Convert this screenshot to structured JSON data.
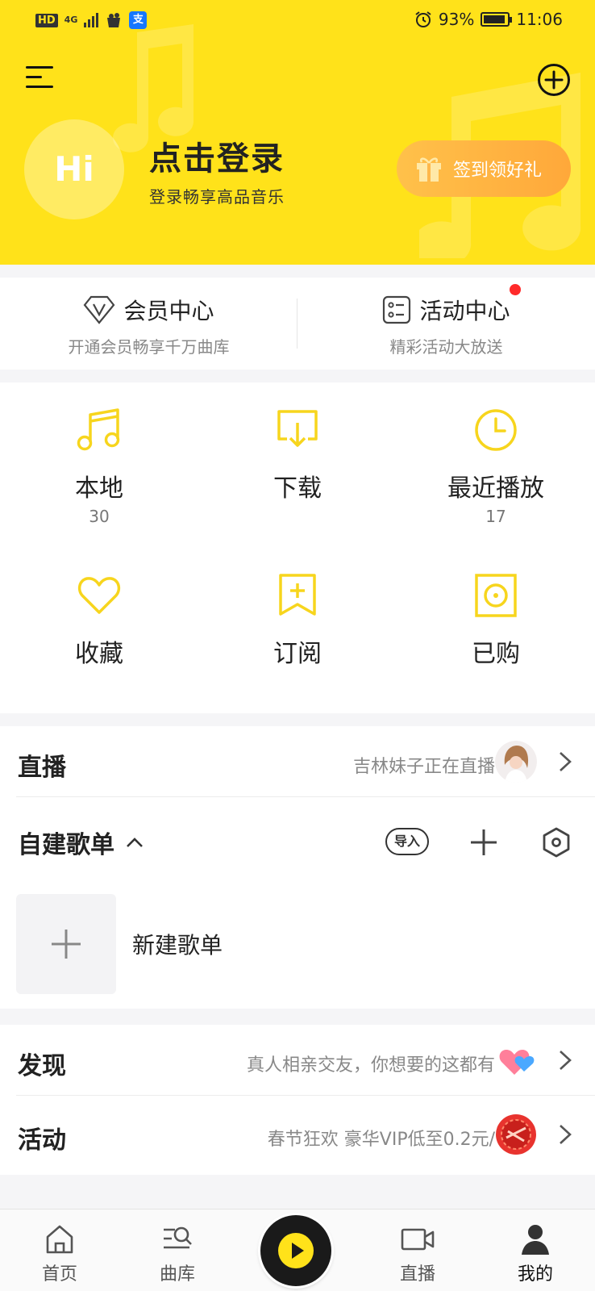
{
  "status_bar": {
    "hd": "HD",
    "network": "4G",
    "battery_percent": "93%",
    "time": "11:06",
    "battery_level": 0.93
  },
  "header": {
    "avatar_text": "Hi",
    "login_title": "点击登录",
    "login_subtitle": "登录畅享高品音乐",
    "checkin_label": "签到领好礼",
    "background_color": "#ffe21a"
  },
  "cards": {
    "vip": {
      "title": "会员中心",
      "subtitle": "开通会员畅享千万曲库",
      "icon": "vip-diamond-icon"
    },
    "activity": {
      "title": "活动中心",
      "subtitle": "精彩活动大放送",
      "icon": "list-card-icon",
      "has_badge": true
    }
  },
  "grid": [
    {
      "label": "本地",
      "count": "30",
      "icon": "music-note-icon"
    },
    {
      "label": "下载",
      "count": "",
      "icon": "download-icon"
    },
    {
      "label": "最近播放",
      "count": "17",
      "icon": "clock-icon"
    },
    {
      "label": "收藏",
      "count": "",
      "icon": "heart-icon"
    },
    {
      "label": "订阅",
      "count": "",
      "icon": "bookmark-plus-icon"
    },
    {
      "label": "已购",
      "count": "",
      "icon": "disc-box-icon"
    }
  ],
  "live": {
    "title": "直播",
    "desc": "吉林妹子正在直播"
  },
  "playlists": {
    "title": "自建歌单",
    "import_label": "导入",
    "new_label": "新建歌单"
  },
  "discover": {
    "title": "发现",
    "desc": "真人相亲交友，你想要的这都有"
  },
  "activity_row": {
    "title": "活动",
    "desc": "春节狂欢 豪华VIP低至0.2元/"
  },
  "bottom_nav": [
    {
      "label": "首页",
      "icon": "home-icon"
    },
    {
      "label": "曲库",
      "icon": "library-search-icon"
    },
    {
      "label": "直播",
      "icon": "video-camera-icon"
    },
    {
      "label": "我的",
      "icon": "user-icon",
      "active": true
    }
  ],
  "accent_color": "#ffe21a",
  "icon_color": "#f7d51d"
}
